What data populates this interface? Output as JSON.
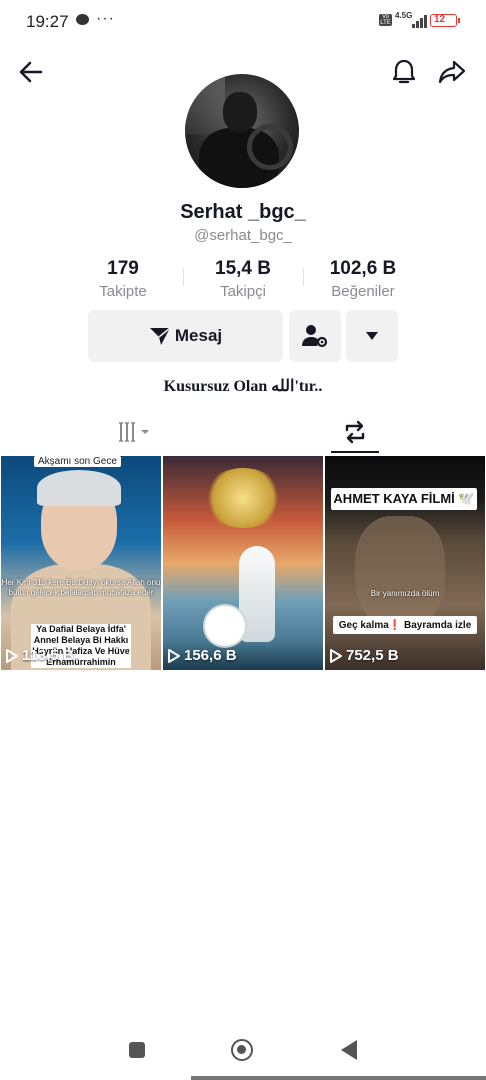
{
  "status_bar": {
    "time": "19:27",
    "dots": "···",
    "network": "4.5G",
    "volte": "Vo LTE",
    "battery": "12"
  },
  "header": {
    "back_icon": "arrow-left-icon",
    "bell_icon": "bell-icon",
    "share_icon": "share-arrow-icon"
  },
  "profile": {
    "display_name": "Serhat _bgc_",
    "username": "@serhat_bgc_",
    "bio": "Kusursuz Olan الله'tır.."
  },
  "stats": [
    {
      "value": "179",
      "label": "Takipte"
    },
    {
      "value": "15,4 B",
      "label": "Takipçi"
    },
    {
      "value": "102,6 B",
      "label": "Beğeniler"
    }
  ],
  "actions": {
    "message_label": "Mesaj",
    "colors": {
      "button_bg": "#f1f1f2",
      "text": "#161823",
      "secondary": "#8a8b91"
    }
  },
  "tabs": [
    {
      "name": "videos",
      "icon": "grid-bars-icon",
      "selected": false
    },
    {
      "name": "reposts",
      "icon": "repost-icon",
      "selected": true
    }
  ],
  "videos": [
    {
      "views": "113,5 B",
      "caption_top": "Akşamı son Gece",
      "overlay_text": "Her Kim 313 kere Bu Duayı okursa Allah onu bütün gelecek belalardan muhafaza eder",
      "box_text": "Ya Dafial Belaya İdfa' Annel Belaya Bi Hakkı Hayrün Hafiza Ve Hüve Erhamürrahimin"
    },
    {
      "views": "156,6 B"
    },
    {
      "views": "752,5 B",
      "title": "AHMET KAYA FİLMİ 🕊️",
      "subtitle": "Bir yanımızda ölüm",
      "note": "Geç kalma❗ Bayramda izle"
    }
  ]
}
